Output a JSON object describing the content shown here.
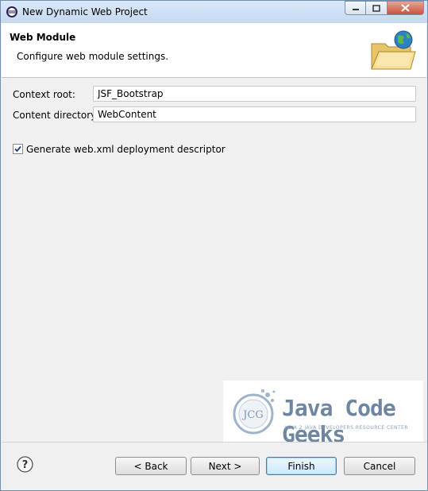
{
  "window": {
    "title": "New Dynamic Web Project"
  },
  "header": {
    "title": "Web Module",
    "description": "Configure web module settings.",
    "icon": "web-module-folder-globe-icon"
  },
  "form": {
    "context_root_label": "Context root:",
    "context_root_value": "JSF_Bootstrap",
    "content_dir_label": "Content directory:",
    "content_dir_value": "WebContent",
    "generate_webxml_label": "Generate web.xml deployment descriptor",
    "generate_webxml_checked": true
  },
  "watermark": {
    "brand": "Java Code Geeks",
    "tagline": "JAVA 2 JAVA DEVELOPERS RESOURCE CENTER",
    "logo_text": "JCG"
  },
  "footer": {
    "back_label": "< Back",
    "next_label": "Next >",
    "finish_label": "Finish",
    "cancel_label": "Cancel"
  },
  "colors": {
    "accent": "#3c7fb1",
    "close_button": "#c9523d"
  }
}
